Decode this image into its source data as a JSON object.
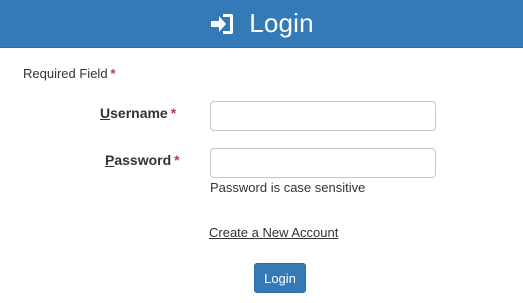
{
  "header": {
    "icon": "sign-in-icon",
    "title": "Login"
  },
  "form": {
    "required_note": "Required Field",
    "required_marker": "*",
    "username": {
      "label_first": "U",
      "label_rest": "sername",
      "value": "",
      "placeholder": ""
    },
    "password": {
      "label_first": "P",
      "label_rest": "assword",
      "value": "",
      "placeholder": "",
      "help": "Password is case sensitive"
    },
    "create_account_link": "Create a New Account",
    "submit_label": "Login"
  },
  "colors": {
    "brand": "#337ab7",
    "required": "#a94442"
  }
}
